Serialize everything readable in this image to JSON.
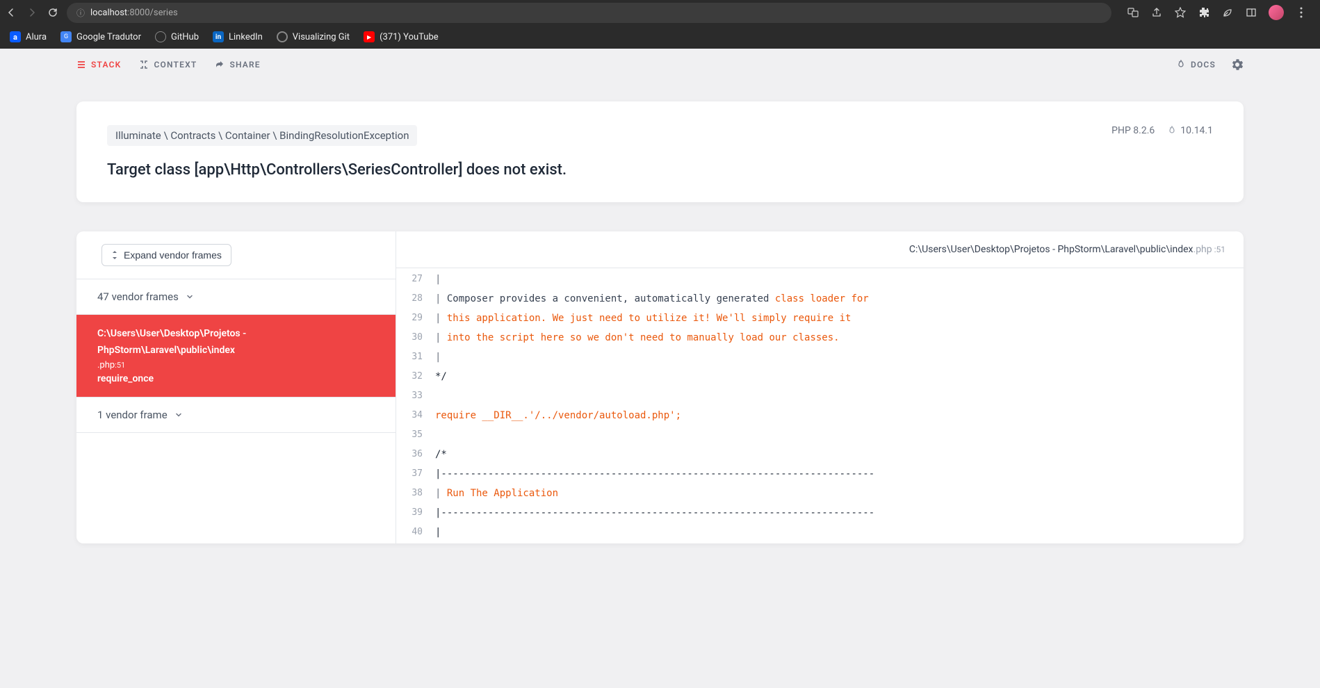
{
  "browser": {
    "url_host": "localhost",
    "url_port": ":8000",
    "url_path": "/series",
    "bookmarks": [
      {
        "label": "Alura",
        "icon": "alura"
      },
      {
        "label": "Google Tradutor",
        "icon": "google"
      },
      {
        "label": "GitHub",
        "icon": "github"
      },
      {
        "label": "LinkedIn",
        "icon": "linkedin"
      },
      {
        "label": "Visualizing Git",
        "icon": "vis"
      },
      {
        "label": "(371) YouTube",
        "icon": "youtube"
      }
    ]
  },
  "nav": {
    "stack": "STACK",
    "context": "CONTEXT",
    "share": "SHARE",
    "docs": "DOCS"
  },
  "error": {
    "exception_class": "Illuminate \\ Contracts \\ Container \\ BindingResolutionException",
    "php_version": "PHP 8.2.6",
    "laravel_version": "10.14.1",
    "message": "Target class [app\\Http\\Controllers\\SeriesController] does not exist."
  },
  "frames": {
    "expand_label": "Expand vendor frames",
    "vendor_count": "47 vendor frames",
    "active": {
      "path1": "C:\\Users\\User\\Desktop\\Projetos -",
      "path2": "PhpStorm\\Laravel\\public\\index",
      "ext": ".php",
      "line": ":51",
      "func": "require_once"
    },
    "vendor_after": "1 vendor frame"
  },
  "code": {
    "file_path": "C:\\Users\\User\\Desktop\\Projetos - PhpStorm\\Laravel\\public\\index",
    "file_ext": ".php",
    "file_line": " :51",
    "lines": [
      {
        "n": "27",
        "pipe": "|"
      },
      {
        "n": "28",
        "pipe": "| ",
        "text_black": "Composer provides a convenient, automatically generated ",
        "text_orange": "class loader for"
      },
      {
        "n": "29",
        "pipe": "| ",
        "text_orange": "this application. We just need to utilize it! We'll simply require it"
      },
      {
        "n": "30",
        "pipe": "| ",
        "text_orange": "into the script here so we don't need to manually load our classes."
      },
      {
        "n": "31",
        "pipe": "|"
      },
      {
        "n": "32",
        "text_dark": "*/"
      },
      {
        "n": "33",
        "text_dark": ""
      },
      {
        "n": "34",
        "text_orange": "require __DIR__.'/../vendor/autoload.php';"
      },
      {
        "n": "35",
        "text_dark": ""
      },
      {
        "n": "36",
        "text_dark": "/*"
      },
      {
        "n": "37",
        "text_dark": "|--------------------------------------------------------------------------"
      },
      {
        "n": "38",
        "pipe": "| ",
        "text_orange": "Run The Application"
      },
      {
        "n": "39",
        "text_dark": "|--------------------------------------------------------------------------"
      },
      {
        "n": "40",
        "text_dark": "|"
      }
    ]
  }
}
